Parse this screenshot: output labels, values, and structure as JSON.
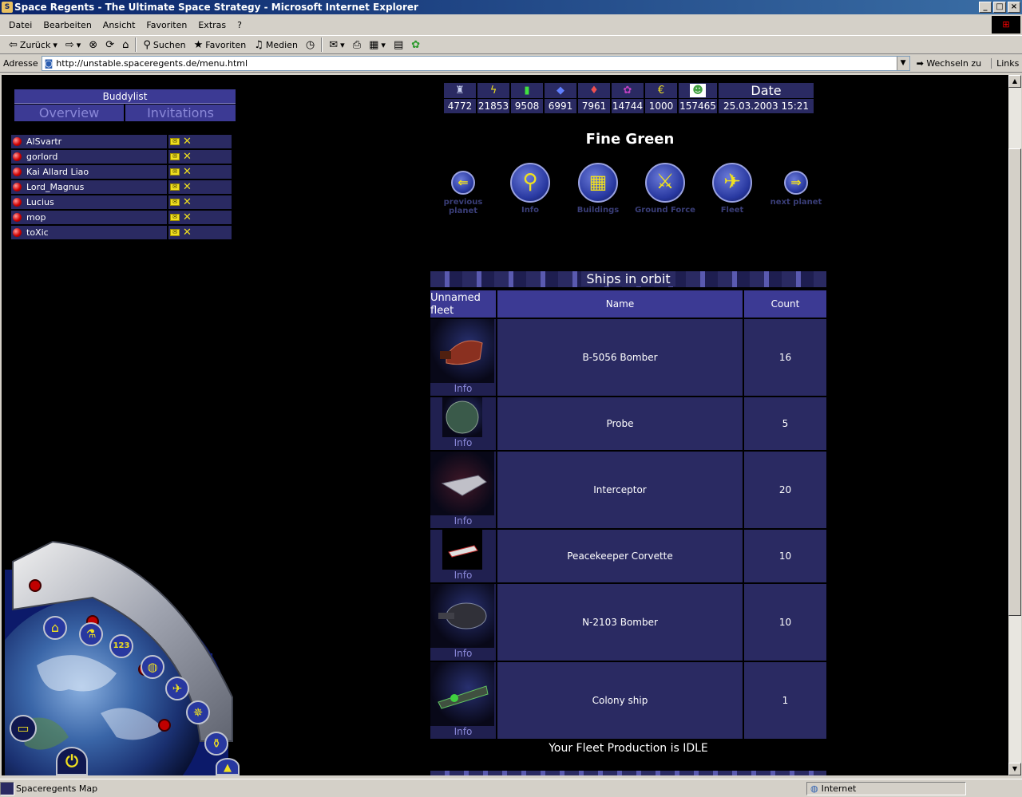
{
  "window": {
    "title": "Space Regents - The Ultimate Space Strategy - Microsoft Internet Explorer"
  },
  "menu": [
    "Datei",
    "Bearbeiten",
    "Ansicht",
    "Favoriten",
    "Extras",
    "?"
  ],
  "toolbar": {
    "back": "Zurück",
    "search": "Suchen",
    "favorites": "Favoriten",
    "media": "Medien"
  },
  "address": {
    "label": "Adresse",
    "url": "http://unstable.spaceregents.de/menu.html",
    "go": "Wechseln zu",
    "links": "Links"
  },
  "status": {
    "text": "Spaceregents Map",
    "zone": "Internet"
  },
  "buddylist": {
    "title": "Buddylist",
    "tabs": [
      "Overview",
      "Invitations"
    ],
    "buddies": [
      "AlSvartr",
      "gorlord",
      "Kai Allard Liao",
      "Lord_Magnus",
      "Lucius",
      "mop",
      "toXic"
    ]
  },
  "resources": {
    "values": [
      "4772",
      "21853",
      "9508",
      "6991",
      "7961",
      "14744",
      "1000",
      "157465"
    ],
    "date_label": "Date",
    "date_value": "25.03.2003 15:21",
    "currency_symbol": "€"
  },
  "planet": {
    "name": "Fine Green",
    "nav": {
      "previous": "previous planet",
      "info": "Info",
      "buildings": "Buildings",
      "ground_force": "Ground Force",
      "fleet": "Fleet",
      "next": "next planet"
    }
  },
  "ships": {
    "title": "Ships in orbit",
    "fleet_label": "Unnamed fleet",
    "col_name": "Name",
    "col_count": "Count",
    "info_label": "Info",
    "rows": [
      {
        "name": "B-5056 Bomber",
        "count": "16"
      },
      {
        "name": "Probe",
        "count": "5"
      },
      {
        "name": "Interceptor",
        "count": "20"
      },
      {
        "name": "Peacekeeper Corvette",
        "count": "10"
      },
      {
        "name": "N-2103 Bomber",
        "count": "10"
      },
      {
        "name": "Colony ship",
        "count": "1"
      }
    ],
    "production_status": "Your Fleet Production is IDLE"
  },
  "colors": {
    "panel": "#2a2a62",
    "header": "#3c3a94",
    "accent": "#f0e020",
    "link": "#8a88d8"
  }
}
